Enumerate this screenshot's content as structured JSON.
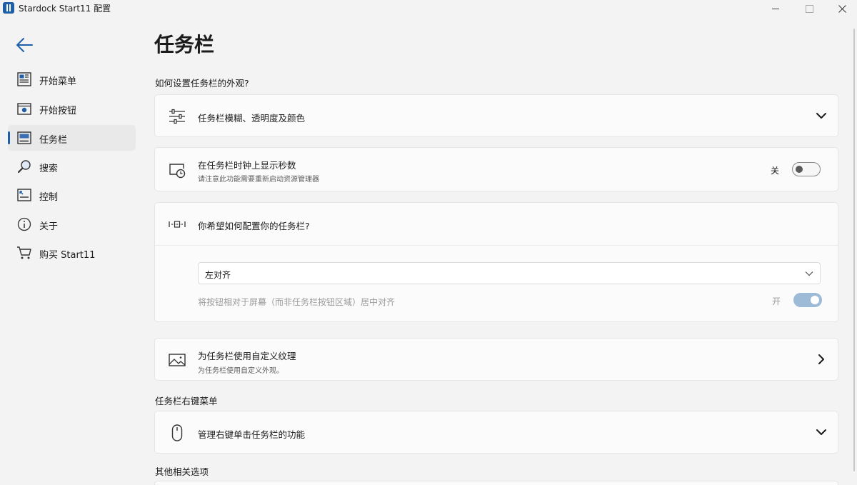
{
  "window": {
    "title": "Stardock Start11 配置"
  },
  "sidebar": {
    "items": [
      {
        "label": "开始菜单",
        "icon": "start-menu-icon"
      },
      {
        "label": "开始按钮",
        "icon": "start-button-icon"
      },
      {
        "label": "任务栏",
        "icon": "taskbar-icon",
        "active": true
      },
      {
        "label": "搜索",
        "icon": "search-icon"
      },
      {
        "label": "控制",
        "icon": "control-icon"
      },
      {
        "label": "关于",
        "icon": "info-icon"
      },
      {
        "label": "购买 Start11",
        "icon": "cart-icon"
      }
    ]
  },
  "main": {
    "title": "任务栏",
    "section1": "如何设置任务栏的外观?",
    "card_blur": {
      "title": "任务栏模糊、透明度及颜色"
    },
    "card_seconds": {
      "title": "在任务栏时钟上显示秒数",
      "subtitle": "请注意此功能需要重新启动资源管理器",
      "toggle_state": "关"
    },
    "card_config": {
      "title": "你希望如何配置你的任务栏?",
      "dropdown_value": "左对齐",
      "center_text": "将按钮相对于屏幕（而非任务栏按钮区域）居中对齐",
      "toggle_state": "开"
    },
    "card_texture": {
      "title": "为任务栏使用自定义纹理",
      "subtitle": "为任务栏使用自定义外观。"
    },
    "section2": "任务栏右键菜单",
    "card_rightclick": {
      "title": "管理右键单击任务栏的功能"
    },
    "section3": "其他相关选项"
  },
  "colors": {
    "accent": "#1f5fa8",
    "toggle_on": "#9dbbd6"
  }
}
